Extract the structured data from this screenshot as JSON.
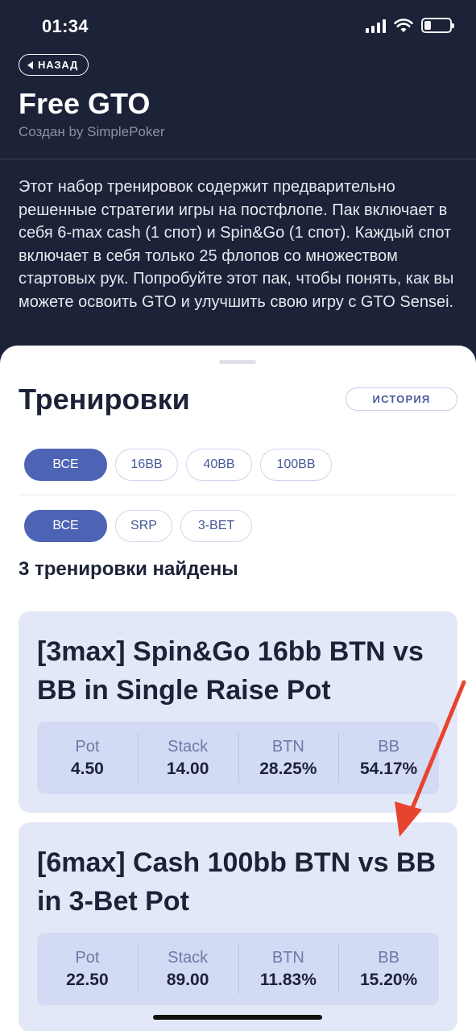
{
  "status_bar": {
    "time": "01:34"
  },
  "header": {
    "back_label": "НАЗАД",
    "title": "Free GTO",
    "subtitle": "Создан by SimplePoker"
  },
  "description": "Этот набор тренировок содержит предварительно решенные стратегии игры на постфлопе. Пак включает в себя 6-max cash (1 спот) и Spin&Go (1 спот). Каждый спот включает в себя только 25 флопов со множеством стартовых рук. Попробуйте этот пак, чтобы понять, как вы можете освоить GTO и улучшить свою игру с GTO Sensei.",
  "trainings": {
    "title": "Тренировки",
    "history_label": "ИСТОРИЯ",
    "stack_filters": [
      {
        "label": "ВСЕ",
        "active": true
      },
      {
        "label": "16BB",
        "active": false
      },
      {
        "label": "40BB",
        "active": false
      },
      {
        "label": "100BB",
        "active": false
      }
    ],
    "pot_filters": [
      {
        "label": "ВСЕ",
        "active": true
      },
      {
        "label": "SRP",
        "active": false
      },
      {
        "label": "3-BET",
        "active": false
      }
    ],
    "results_count": "3 тренировки найдены",
    "cards": [
      {
        "title": "[3max] Spin&Go 16bb BTN vs BB in Single Raise Pot",
        "stats": [
          {
            "label": "Pot",
            "value": "4.50"
          },
          {
            "label": "Stack",
            "value": "14.00"
          },
          {
            "label": "BTN",
            "value": "28.25%"
          },
          {
            "label": "BB",
            "value": "54.17%"
          }
        ]
      },
      {
        "title": "[6max] Cash 100bb BTN vs BB in 3-Bet Pot",
        "stats": [
          {
            "label": "Pot",
            "value": "22.50"
          },
          {
            "label": "Stack",
            "value": "89.00"
          },
          {
            "label": "BTN",
            "value": "11.83%"
          },
          {
            "label": "BB",
            "value": "15.20%"
          }
        ]
      }
    ]
  },
  "colors": {
    "header_bg": "#1c2238",
    "accent": "#4d64b6",
    "card_bg": "#e3e8f8",
    "annotation_arrow": "#e8432e"
  },
  "icons": [
    "back-arrow-icon",
    "signal-icon",
    "wifi-icon",
    "battery-icon"
  ]
}
